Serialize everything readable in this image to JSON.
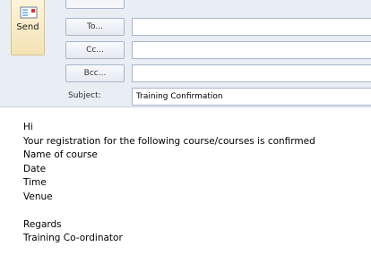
{
  "toolbar": {
    "send_label": "Send",
    "send_icon": "send-envelope-icon"
  },
  "addressing": {
    "to_label": "To...",
    "cc_label": "Cc...",
    "bcc_label": "Bcc...",
    "to_value": "",
    "cc_value": "",
    "bcc_value": "",
    "subject_label": "Subject:",
    "subject_value": "Training Confirmation"
  },
  "message": {
    "lines": [
      "Hi",
      "Your registration for the following course/courses is confirmed",
      "Name of course",
      "Date",
      "Time",
      "Venue",
      "",
      "Regards",
      "Training Co-ordinator"
    ]
  },
  "colors": {
    "header_bg": "#e9eef5",
    "send_button_bg": "#f4e3b5",
    "border": "#a9b6c8"
  }
}
